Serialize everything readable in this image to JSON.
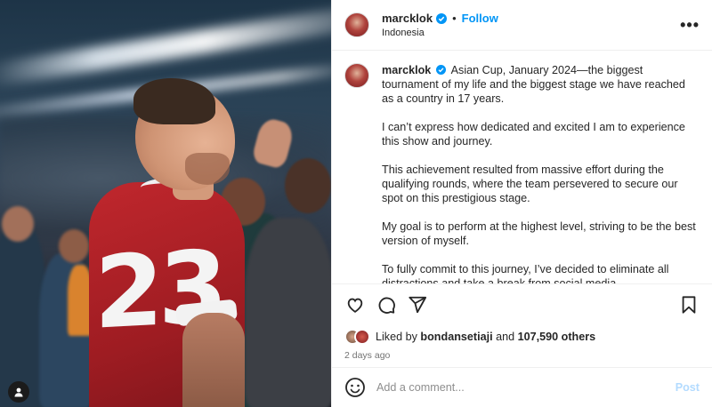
{
  "photo": {
    "jersey_number": "23",
    "user_tag_icon": "person-icon"
  },
  "header": {
    "username": "marcklok",
    "verified_icon": "verified-badge-icon",
    "separator": "•",
    "follow_label": "Follow",
    "location": "Indonesia",
    "more_icon": "more-options-icon",
    "more_label": "•••"
  },
  "caption": {
    "username": "marcklok",
    "paragraphs": [
      "Asian Cup, January 2024—the biggest tournament of my life and the biggest stage we have reached as a country in 17 years.",
      "I can’t express how dedicated and excited I am to experience this show and journey.",
      "This achievement resulted from massive effort during the qualifying rounds, where the team persevered to secure our spot on this prestigious stage.",
      "My goal is to perform at the highest level, striving to be the best version of myself.",
      "To fully commit to this journey, I’ve decided to eliminate all distractions and take a break from social media."
    ]
  },
  "actions": {
    "like_icon": "heart-icon",
    "comment_icon": "comment-icon",
    "share_icon": "share-icon",
    "save_icon": "bookmark-icon"
  },
  "likes": {
    "prefix": "Liked by",
    "user": "bondansetiaji",
    "conjunction": "and",
    "count": "107,590 others"
  },
  "timestamp": "2 days ago",
  "comment": {
    "emoji_icon": "emoji-icon",
    "placeholder": "Add a comment...",
    "post_label": "Post"
  },
  "colors": {
    "link_blue": "#0095f6",
    "post_disabled": "#b3dbff",
    "secondary_text": "#737373",
    "jersey_red": "#c0272d"
  }
}
